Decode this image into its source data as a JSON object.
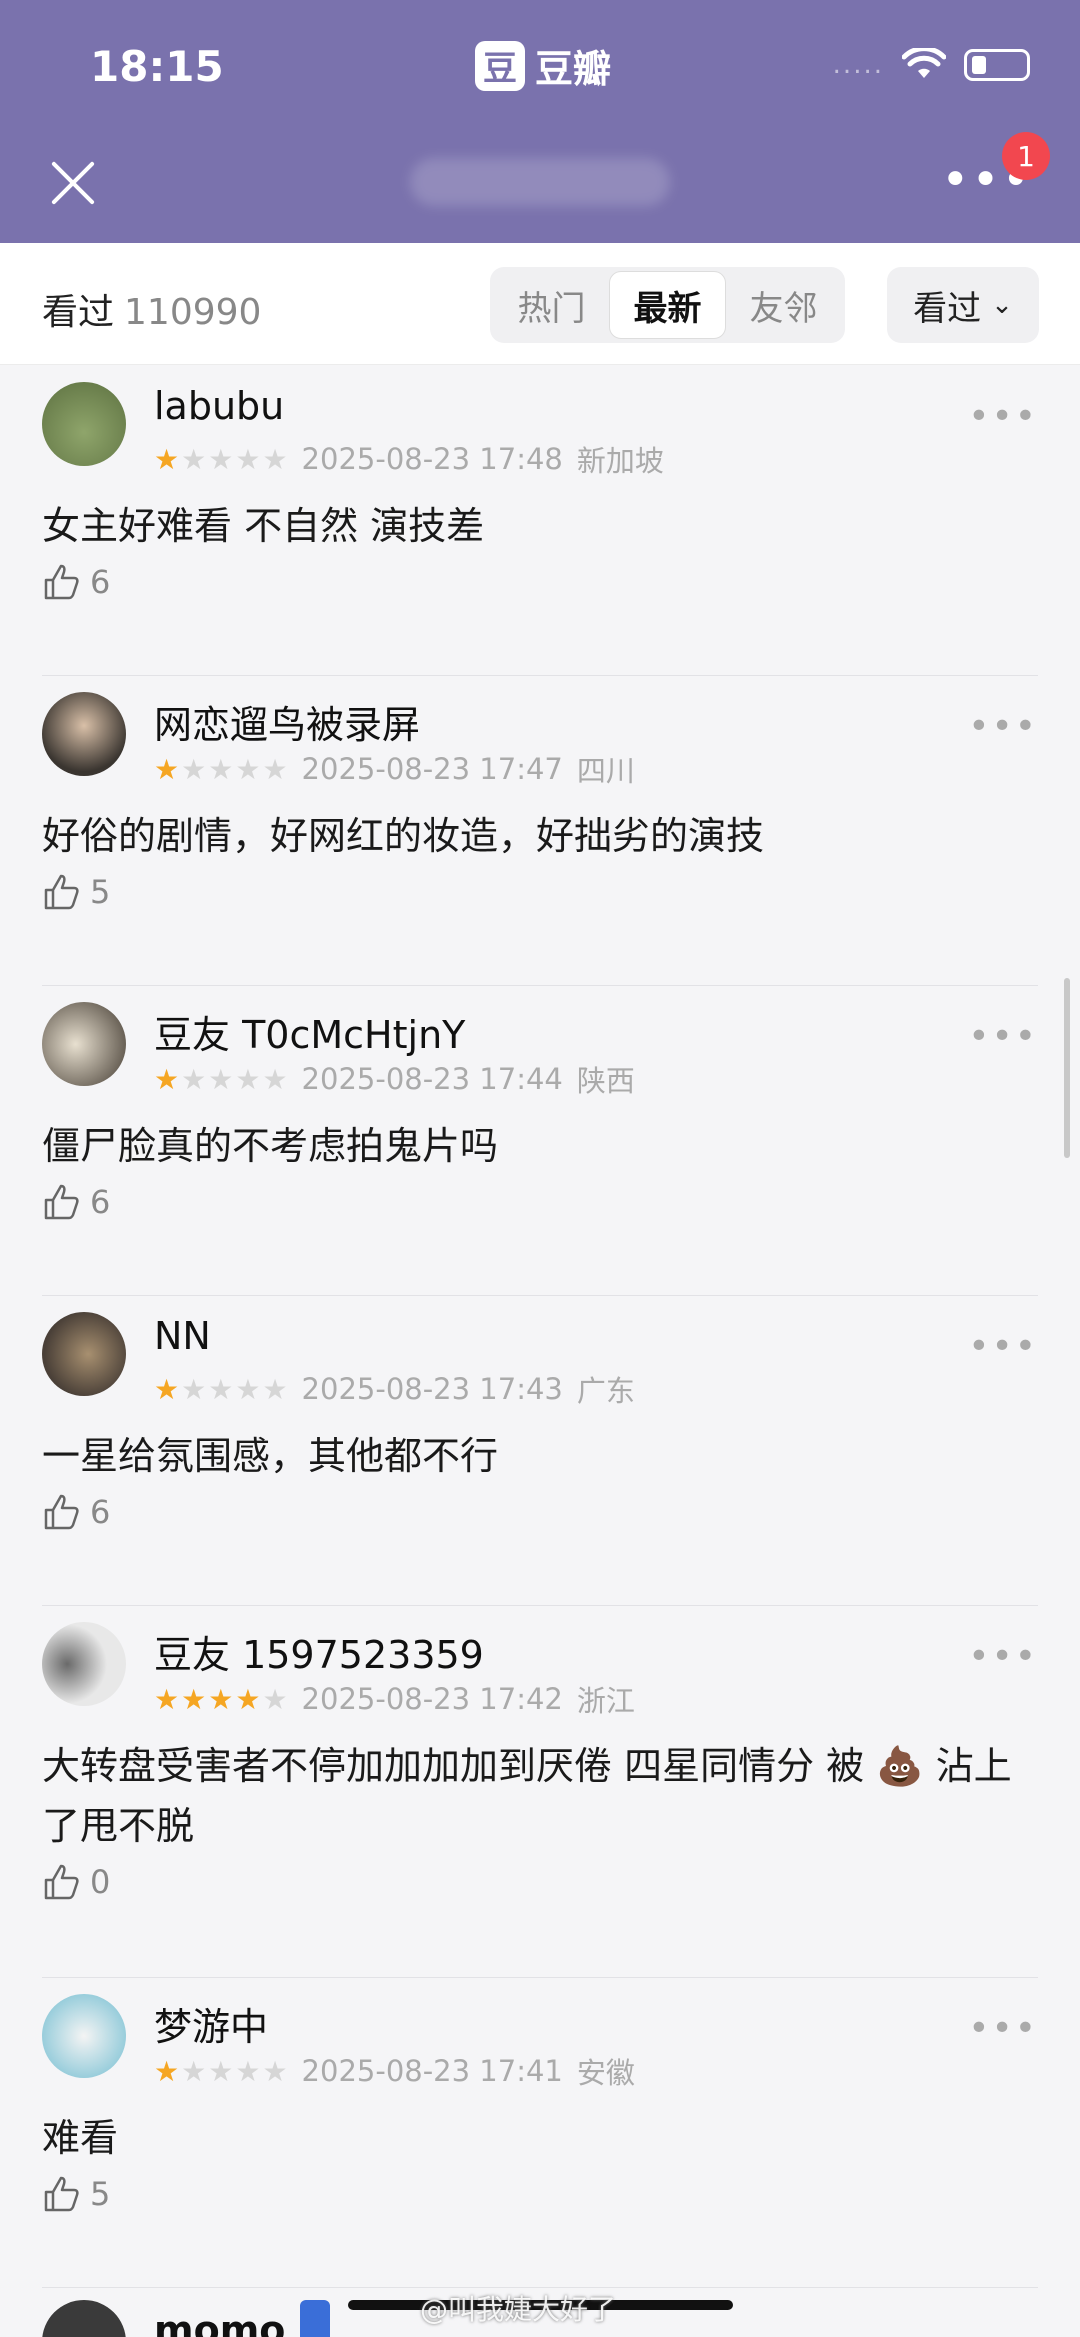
{
  "status": {
    "time": "18:15",
    "app_name": "豆瓣",
    "app_logo_char": "豆",
    "signal": "....."
  },
  "header": {
    "notification_count": "1"
  },
  "filter": {
    "seen_label": "看过",
    "seen_count": "110990",
    "tabs": [
      "热门",
      "最新",
      "友邻"
    ],
    "active_tab": "最新",
    "dropdown_label": "看过"
  },
  "reviews": [
    {
      "user": "labubu",
      "rating": 1,
      "time": "2025-08-23 17:48",
      "location": "新加坡",
      "comment": "女主好难看 不自然 演技差",
      "likes": "6"
    },
    {
      "user": "网恋遛鸟被录屏",
      "rating": 1,
      "time": "2025-08-23 17:47",
      "location": "四川",
      "comment": "好俗的剧情，好网红的妆造，好拙劣的演技",
      "likes": "5"
    },
    {
      "user": "豆友 T0cMcHtjnY",
      "rating": 1,
      "time": "2025-08-23 17:44",
      "location": "陕西",
      "comment": "僵尸脸真的不考虑拍鬼片吗",
      "likes": "6"
    },
    {
      "user": "NN",
      "rating": 1,
      "time": "2025-08-23 17:43",
      "location": "广东",
      "comment": "一星给氛围感，其他都不行",
      "likes": "6"
    },
    {
      "user": "豆友 1597523359",
      "rating": 4,
      "time": "2025-08-23 17:42",
      "location": "浙江",
      "comment": "大转盘受害者不停加加加加到厌倦 四星同情分 被 💩 沾上了甩不脱",
      "likes": "0"
    },
    {
      "user": "梦游中",
      "rating": 1,
      "time": "2025-08-23 17:41",
      "location": "安徽",
      "comment": "难看",
      "likes": "5"
    }
  ],
  "partial_user": "momo",
  "watermark": "@叫我婕大好了",
  "colors": {
    "header": "#7a72ad",
    "star": "#f5a623",
    "badge": "#f2474f"
  }
}
